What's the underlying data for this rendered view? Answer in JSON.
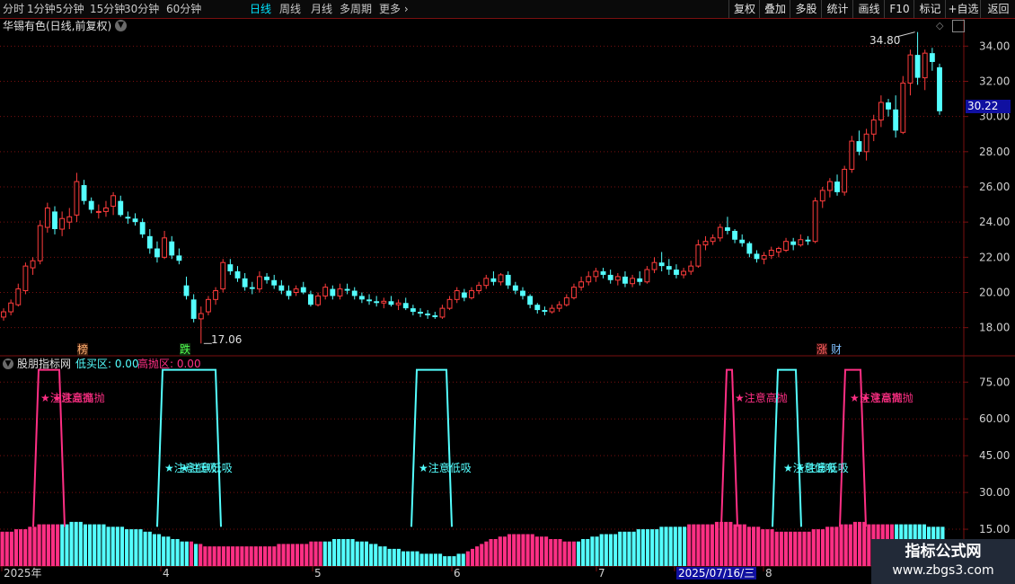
{
  "toolbar": {
    "periods": [
      "分时",
      "1分钟",
      "5分钟",
      "15分钟",
      "30分钟",
      "60分钟",
      "日线",
      "周线",
      "月线",
      "多周期",
      "更多"
    ],
    "active_period": "日线",
    "right_buttons": [
      "复权",
      "叠加",
      "多股",
      "统计",
      "画线",
      "F10",
      "标记",
      "+自选",
      "返回"
    ]
  },
  "main_panel": {
    "title": "华锡有色(日线,前复权)",
    "last_price": "30.22",
    "high_label": "34.80",
    "low_label": "17.06",
    "markers": [
      "榜",
      "跌",
      "涨",
      "财"
    ]
  },
  "indicator_panel": {
    "name": "股朋指标网",
    "low_buy_label": "低买区: 0.00",
    "high_sell_label": "高抛区: 0.00",
    "signal_sell": "注意高抛",
    "signal_buy": "注意低吸"
  },
  "date_axis": {
    "labels": [
      "2025年",
      "4",
      "5",
      "6",
      "7",
      "2025/07/16/三",
      "8"
    ]
  },
  "watermark": {
    "title": "指标公式网",
    "url": "www.zbgs3.com"
  },
  "colors": {
    "up": "#ff3c3c",
    "down": "#54ffff",
    "sell": "#ff2f84",
    "buy": "#54ffff",
    "grid": "#7a1010"
  },
  "chart_data": {
    "type": "candlestick",
    "y_ticks": [
      "34.00",
      "32.00",
      "30.00",
      "28.00",
      "26.00",
      "24.00",
      "22.00",
      "20.00",
      "18.00"
    ],
    "ylim": [
      16.4,
      35.6
    ],
    "indicator_y_ticks": [
      "75.00",
      "60.00",
      "45.00",
      "30.00",
      "15.00"
    ],
    "indicator_ylim": [
      0,
      85
    ],
    "ohlc": [
      [
        18.6,
        19.1,
        18.4,
        18.9
      ],
      [
        18.9,
        19.6,
        18.7,
        19.4
      ],
      [
        19.3,
        20.5,
        19.2,
        20.2
      ],
      [
        20.1,
        21.7,
        19.9,
        21.5
      ],
      [
        21.4,
        22.0,
        21.0,
        21.8
      ],
      [
        21.8,
        24.1,
        21.6,
        23.8
      ],
      [
        23.7,
        25.1,
        23.4,
        24.8
      ],
      [
        24.6,
        24.9,
        23.3,
        23.6
      ],
      [
        23.6,
        24.6,
        23.2,
        24.2
      ],
      [
        24.0,
        24.8,
        23.6,
        24.3
      ],
      [
        24.4,
        26.8,
        24.0,
        26.3
      ],
      [
        26.1,
        26.4,
        25.0,
        25.2
      ],
      [
        25.2,
        25.4,
        24.5,
        24.7
      ],
      [
        24.6,
        25.0,
        24.2,
        24.6
      ],
      [
        24.6,
        25.2,
        24.3,
        24.8
      ],
      [
        24.9,
        25.7,
        24.4,
        25.5
      ],
      [
        25.2,
        25.5,
        24.3,
        24.4
      ],
      [
        24.3,
        24.6,
        23.9,
        24.2
      ],
      [
        24.2,
        24.5,
        23.8,
        24.0
      ],
      [
        24.0,
        24.2,
        23.1,
        23.3
      ],
      [
        23.2,
        23.6,
        22.2,
        22.5
      ],
      [
        22.5,
        22.9,
        21.7,
        22.0
      ],
      [
        22.0,
        23.5,
        21.9,
        23.1
      ],
      [
        22.9,
        23.2,
        21.9,
        22.1
      ],
      [
        22.1,
        22.5,
        21.6,
        21.8
      ],
      [
        20.4,
        20.9,
        19.6,
        19.8
      ],
      [
        19.6,
        19.9,
        18.3,
        18.5
      ],
      [
        18.5,
        19.2,
        17.1,
        18.8
      ],
      [
        18.9,
        19.8,
        18.7,
        19.6
      ],
      [
        19.6,
        20.3,
        19.3,
        20.1
      ],
      [
        20.2,
        21.9,
        20.0,
        21.7
      ],
      [
        21.6,
        21.9,
        21.0,
        21.2
      ],
      [
        21.2,
        21.5,
        20.6,
        20.8
      ],
      [
        20.8,
        21.1,
        20.1,
        20.3
      ],
      [
        20.3,
        20.6,
        19.9,
        20.2
      ],
      [
        20.2,
        21.2,
        20.0,
        20.9
      ],
      [
        20.9,
        21.1,
        20.5,
        20.7
      ],
      [
        20.7,
        21.0,
        20.2,
        20.4
      ],
      [
        20.4,
        20.7,
        19.9,
        20.1
      ],
      [
        20.1,
        20.4,
        19.6,
        19.8
      ],
      [
        20.0,
        20.4,
        19.8,
        20.2
      ],
      [
        20.3,
        20.6,
        19.9,
        20.0
      ],
      [
        19.9,
        20.1,
        19.2,
        19.3
      ],
      [
        19.3,
        20.0,
        19.2,
        19.8
      ],
      [
        19.8,
        20.5,
        19.6,
        20.3
      ],
      [
        20.2,
        20.4,
        19.6,
        19.8
      ],
      [
        19.8,
        20.5,
        19.6,
        20.2
      ],
      [
        20.2,
        20.5,
        19.9,
        20.1
      ],
      [
        20.1,
        20.3,
        19.6,
        19.8
      ],
      [
        19.8,
        20.0,
        19.4,
        19.6
      ],
      [
        19.6,
        19.9,
        19.3,
        19.5
      ],
      [
        19.5,
        19.8,
        19.2,
        19.4
      ],
      [
        19.4,
        19.7,
        19.1,
        19.5
      ],
      [
        19.5,
        19.8,
        19.2,
        19.3
      ],
      [
        19.3,
        19.6,
        19.0,
        19.4
      ],
      [
        19.4,
        19.7,
        19.0,
        19.1
      ],
      [
        19.1,
        19.3,
        18.7,
        18.9
      ],
      [
        18.9,
        19.1,
        18.6,
        18.8
      ],
      [
        18.8,
        19.0,
        18.5,
        18.7
      ],
      [
        18.7,
        18.9,
        18.5,
        18.6
      ],
      [
        18.6,
        19.3,
        18.5,
        19.1
      ],
      [
        19.1,
        19.8,
        19.0,
        19.6
      ],
      [
        19.6,
        20.3,
        19.4,
        20.1
      ],
      [
        20.0,
        20.2,
        19.5,
        19.7
      ],
      [
        19.7,
        20.3,
        19.6,
        20.1
      ],
      [
        20.1,
        20.6,
        19.9,
        20.4
      ],
      [
        20.4,
        21.0,
        20.2,
        20.8
      ],
      [
        20.8,
        21.2,
        20.4,
        20.6
      ],
      [
        20.6,
        21.1,
        20.4,
        21.0
      ],
      [
        21.0,
        21.2,
        20.2,
        20.4
      ],
      [
        20.4,
        20.6,
        19.9,
        20.1
      ],
      [
        20.1,
        20.3,
        19.6,
        19.8
      ],
      [
        19.8,
        19.9,
        19.1,
        19.3
      ],
      [
        19.3,
        19.4,
        18.8,
        19.0
      ],
      [
        19.0,
        19.2,
        18.7,
        18.9
      ],
      [
        18.9,
        19.3,
        18.8,
        19.1
      ],
      [
        19.1,
        19.5,
        18.9,
        19.3
      ],
      [
        19.3,
        19.9,
        19.2,
        19.7
      ],
      [
        19.7,
        20.5,
        19.6,
        20.3
      ],
      [
        20.3,
        20.9,
        20.1,
        20.6
      ],
      [
        20.6,
        21.2,
        20.4,
        20.9
      ],
      [
        20.9,
        21.4,
        20.6,
        21.2
      ],
      [
        21.2,
        21.4,
        20.8,
        21.0
      ],
      [
        21.0,
        21.3,
        20.5,
        20.7
      ],
      [
        20.7,
        21.1,
        20.4,
        20.9
      ],
      [
        20.9,
        21.2,
        20.3,
        20.5
      ],
      [
        20.5,
        21.0,
        20.3,
        20.8
      ],
      [
        20.8,
        21.2,
        20.4,
        20.6
      ],
      [
        20.6,
        21.5,
        20.5,
        21.3
      ],
      [
        21.3,
        22.0,
        21.1,
        21.7
      ],
      [
        21.7,
        22.3,
        21.2,
        21.5
      ],
      [
        21.5,
        21.9,
        21.0,
        21.3
      ],
      [
        21.3,
        21.6,
        20.8,
        21.0
      ],
      [
        21.0,
        21.4,
        20.8,
        21.2
      ],
      [
        21.2,
        21.8,
        21.0,
        21.5
      ],
      [
        21.5,
        23.0,
        21.4,
        22.7
      ],
      [
        22.7,
        23.2,
        22.4,
        22.9
      ],
      [
        22.9,
        23.3,
        22.7,
        23.1
      ],
      [
        23.1,
        23.9,
        22.9,
        23.7
      ],
      [
        23.7,
        24.3,
        23.3,
        23.5
      ],
      [
        23.5,
        23.6,
        22.8,
        23.0
      ],
      [
        23.0,
        23.3,
        22.6,
        22.8
      ],
      [
        22.8,
        22.9,
        22.0,
        22.2
      ],
      [
        22.2,
        22.4,
        21.7,
        21.9
      ],
      [
        21.9,
        22.3,
        21.6,
        22.1
      ],
      [
        22.1,
        22.6,
        21.9,
        22.4
      ],
      [
        22.3,
        22.6,
        22.0,
        22.5
      ],
      [
        22.4,
        23.1,
        22.3,
        22.9
      ],
      [
        22.9,
        23.1,
        22.4,
        22.7
      ],
      [
        22.7,
        23.3,
        22.6,
        23.0
      ],
      [
        23.0,
        23.2,
        22.7,
        22.9
      ],
      [
        22.9,
        25.4,
        22.8,
        25.2
      ],
      [
        25.2,
        26.0,
        24.8,
        25.8
      ],
      [
        25.8,
        26.5,
        25.4,
        26.3
      ],
      [
        26.3,
        26.7,
        25.5,
        25.7
      ],
      [
        25.7,
        27.2,
        25.5,
        27.0
      ],
      [
        27.0,
        28.9,
        26.8,
        28.6
      ],
      [
        28.6,
        29.2,
        27.8,
        28.0
      ],
      [
        28.0,
        29.3,
        27.5,
        29.0
      ],
      [
        29.0,
        30.1,
        28.6,
        29.8
      ],
      [
        29.8,
        31.2,
        29.4,
        30.8
      ],
      [
        30.8,
        31.0,
        30.0,
        30.4
      ],
      [
        30.4,
        31.2,
        28.8,
        29.2
      ],
      [
        29.1,
        32.3,
        29.0,
        31.9
      ],
      [
        31.9,
        33.8,
        31.2,
        33.5
      ],
      [
        33.5,
        34.8,
        31.8,
        32.2
      ],
      [
        32.2,
        33.8,
        31.5,
        33.6
      ],
      [
        33.6,
        33.9,
        32.6,
        33.1
      ],
      [
        32.8,
        33.0,
        30.1,
        30.3
      ]
    ],
    "indicator_bar_colors": "mmmmmmmmmmmmmccccccccccccccccccccccccccccmcmmmmmmmmmmmmmmmmmmmmmmmmmmmcccccccccccccccccccccccccccccccmmmmmmmmmmmmmmmmmmmmmmmmccccccccccccccccccccccccmmmmmmmmmmmmmmmmmmmmmmmmmmmmmmmmmmmmmmmmmmmmmccccccccccccccccccccccccccccccccmmmmmmmmmmmmmcccccccccccccccccc",
    "indicator_bars": [
      14,
      14,
      14,
      15,
      15,
      15,
      16,
      16,
      17,
      17,
      17,
      17,
      17,
      17,
      17,
      18,
      18,
      18,
      17,
      17,
      17,
      17,
      17,
      16,
      16,
      16,
      16,
      15,
      15,
      15,
      15,
      14,
      14,
      13,
      13,
      12,
      12,
      11,
      11,
      10,
      10,
      10,
      9,
      9,
      8,
      8,
      8,
      8,
      8,
      8,
      8,
      8,
      8,
      8,
      8,
      8,
      8,
      8,
      8,
      8,
      9,
      9,
      9,
      9,
      9,
      9,
      9,
      10,
      10,
      10,
      10,
      10,
      11,
      11,
      11,
      11,
      11,
      10,
      10,
      10,
      9,
      9,
      8,
      8,
      7,
      7,
      7,
      6,
      6,
      6,
      6,
      5,
      5,
      5,
      5,
      5,
      4,
      4,
      4,
      5,
      5,
      6,
      7,
      8,
      9,
      10,
      11,
      11,
      12,
      12,
      13,
      13,
      13,
      13,
      13,
      13,
      12,
      12,
      12,
      11,
      11,
      11,
      10,
      10,
      10,
      10,
      11,
      11,
      12,
      12,
      13,
      13,
      13,
      13,
      14,
      14,
      14,
      14,
      15,
      15,
      15,
      15,
      15,
      16,
      16,
      16,
      16,
      16,
      16,
      17,
      17,
      17,
      17,
      17,
      17,
      18,
      18,
      18,
      18,
      17,
      17,
      17,
      16,
      16,
      16,
      15,
      15,
      15,
      14,
      14,
      14,
      14,
      14,
      14,
      14,
      14,
      15,
      15,
      15,
      16,
      16,
      16,
      17,
      17,
      17,
      18,
      18,
      18,
      17,
      17,
      17,
      17,
      17,
      17,
      17,
      17,
      17,
      17,
      17,
      17,
      17,
      16,
      16,
      16,
      16
    ],
    "sell_segments": [
      [
        37,
        43,
        66,
        72
      ],
      [
        803,
        809,
        815,
        821
      ],
      [
        935,
        941,
        958,
        964
      ]
    ],
    "buy_segments": [
      [
        175,
        181,
        240,
        246
      ],
      [
        458,
        464,
        497,
        503
      ],
      [
        860,
        866,
        886,
        892
      ]
    ],
    "sell_signal_points": [
      [
        45,
        443
      ],
      [
        58,
        443
      ],
      [
        818,
        443
      ],
      [
        946,
        443
      ],
      [
        958,
        443
      ]
    ],
    "buy_signal_points": [
      [
        183,
        521
      ],
      [
        200,
        521
      ],
      [
        466,
        521
      ],
      [
        872,
        521
      ],
      [
        886,
        521
      ]
    ]
  }
}
